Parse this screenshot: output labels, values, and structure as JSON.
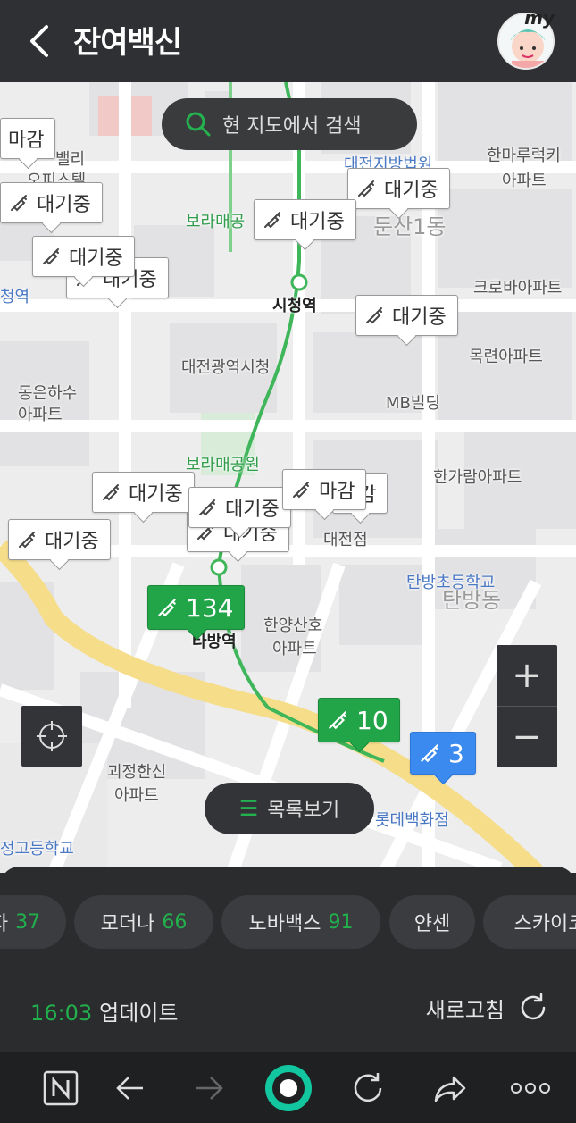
{
  "header": {
    "title": "잔여백신",
    "avatar_badge": "my"
  },
  "map": {
    "search_label": "현 지도에서 검색",
    "list_label": "목록보기",
    "zoom_in": "+",
    "zoom_out": "−",
    "labels": {
      "l1": "대전지방법원",
      "l2": "한마루럭키",
      "l3": "아파트",
      "l4": "보라매공",
      "l5": "둔산1동",
      "l6": "크로바아파트",
      "l7": "시청역",
      "l8": "목련아파트",
      "l9": "대전광역시청",
      "l10": "MB빌딩",
      "l11": "동은하수",
      "l12": "아파트",
      "l13": "보라매공원",
      "l14": "한가람아파트",
      "l15": "탄방초등학교",
      "l16": "탄방동",
      "l17": "한양산호",
      "l18": "아파트",
      "l19": "괴정한신",
      "l20": "아파트",
      "l21": "롯데백화점",
      "l22": "정고등학교",
      "l23": "밸리",
      "l24": "오피스텔",
      "l25": "타방역",
      "l26": "시청역",
      "l27": "대전점",
      "l28": "청역",
      "l29": "정"
    },
    "markers": {
      "m_top": "대기중",
      "m_a": "마감",
      "m_b": "대기중",
      "m_c": "대기중",
      "m_c2": "대기중",
      "m_d": "대기중",
      "m_e": "대기중",
      "m_f": "대기중",
      "m_g": "대기중",
      "m_h": "대기중",
      "m_i": "대기중",
      "m_j": "마감",
      "m_k": "마감",
      "m_l": "대기중",
      "m_m": "대기중",
      "m_green1": "134",
      "m_green2": "10",
      "m_blue": "3"
    }
  },
  "sheet": {
    "chips": [
      {
        "label": "자",
        "count": "37"
      },
      {
        "label": "모더나",
        "count": "66"
      },
      {
        "label": "노바백스",
        "count": "91"
      },
      {
        "label": "얀센",
        "count": ""
      },
      {
        "label": "스카이코",
        "count": ""
      }
    ],
    "update_time": "16:03",
    "update_label": "업데이트",
    "refresh_label": "새로고침"
  },
  "colors": {
    "accent_green": "#22a548",
    "accent_blue": "#3b8af0",
    "header_bg": "#2f3033"
  },
  "browser_nav": {
    "icons": [
      "naver-icon",
      "back-arrow-icon",
      "forward-arrow-icon",
      "home-circle-icon",
      "reload-icon",
      "share-icon",
      "more-icon"
    ]
  }
}
